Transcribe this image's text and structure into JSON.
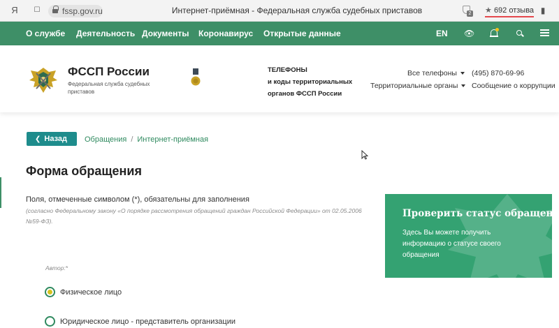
{
  "browser": {
    "url": "fssp.gov.ru",
    "title": "Интернет-приёмная - Федеральная служба судебных приставов",
    "reviews": "692 отзыва",
    "badge_count": "2"
  },
  "nav": {
    "items": [
      "О службе",
      "Деятельность",
      "Документы",
      "Коронавирус",
      "Открытые данные"
    ],
    "lang": "EN"
  },
  "header": {
    "site_name": "ФССП России",
    "site_sub": "Федеральная служба судебных приставов",
    "phones_title_line1": "ТЕЛЕФОНЫ",
    "phones_title_line2": "и коды территориальных",
    "phones_title_line3": "органов ФССП России",
    "all_phones": "Все телефоны",
    "territorial": "Территориальные органы",
    "phone": "(495) 870-69-96",
    "corruption": "Сообщение о коррупции"
  },
  "content": {
    "back": "Назад",
    "crumb1": "Обращения",
    "crumb_sep": "/",
    "crumb2": "Интернет-приёмная",
    "form_title": "Форма обращения",
    "required_note": "Поля, отмеченные символом (*), обязательны для заполнения",
    "law_note": "(согласно Федеральному закону «О порядке рассмотрения обращений граждан Российской Федерации» от 02.05.2006 №59-ФЗ).",
    "author_label": "Автор:*",
    "options": [
      "Физическое лицо",
      "Юридическое лицо - представитель организации"
    ]
  },
  "status_card": {
    "title": "Проверить статус обращения",
    "desc": "Здесь Вы можете получить информацию о статусе своего обращения"
  },
  "colors": {
    "nav_green": "#3e8f67",
    "back_teal": "#1e8c8c",
    "card_green": "#34a272",
    "radio_dot": "#d4c21e"
  }
}
